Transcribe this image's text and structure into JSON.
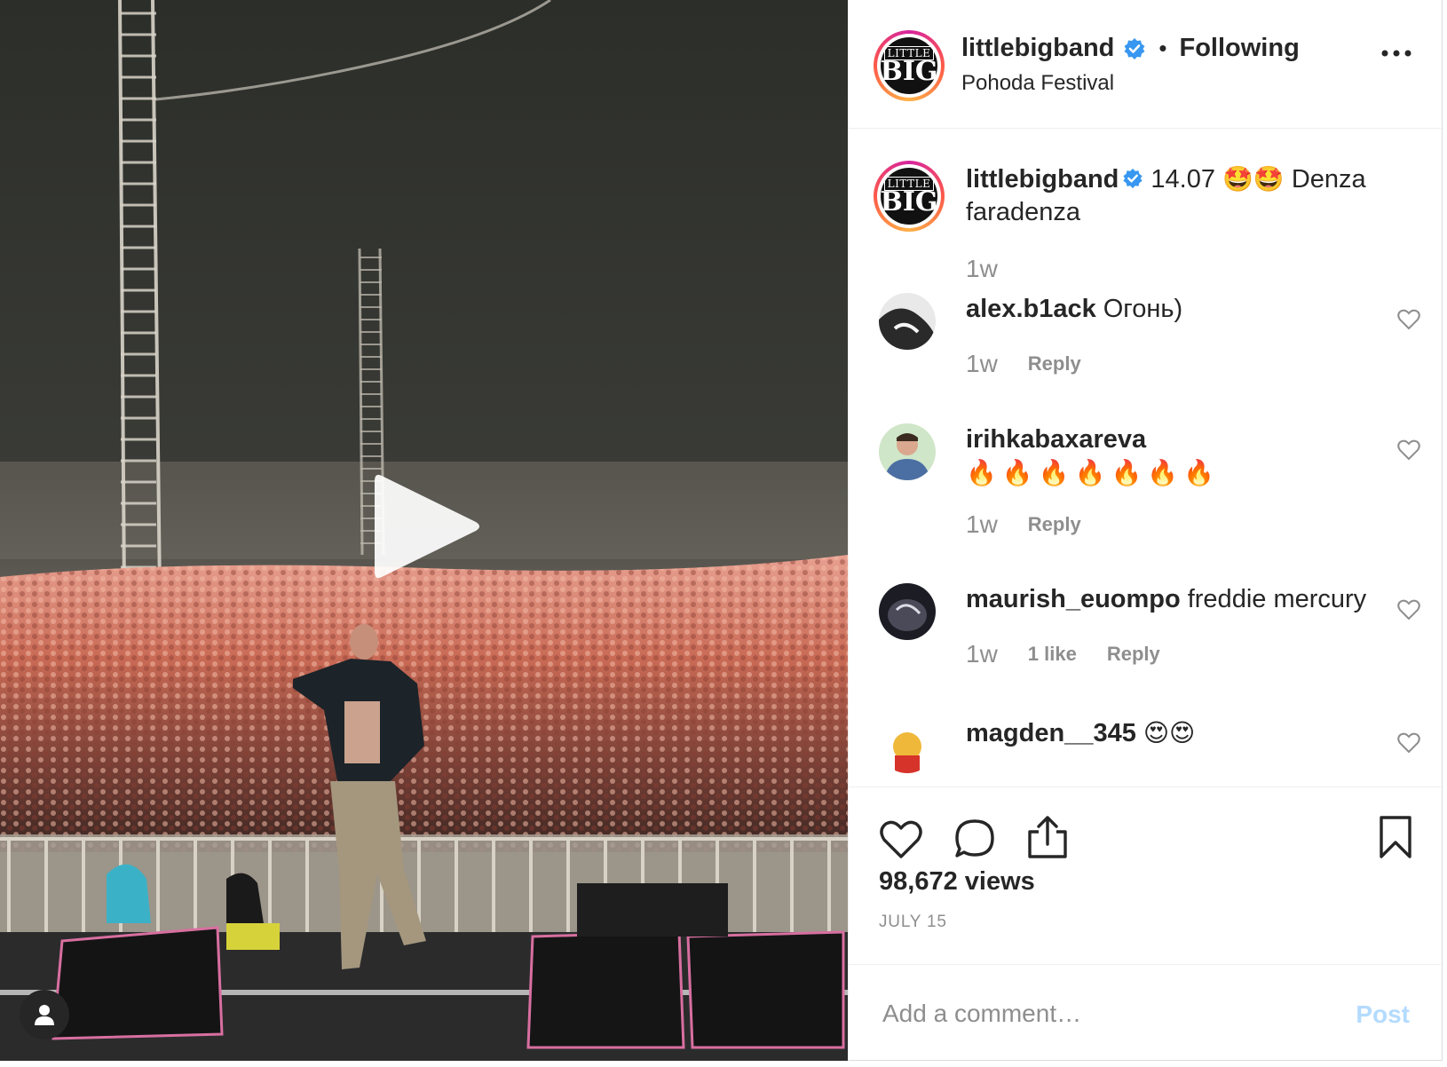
{
  "post": {
    "author": "littlebigband",
    "follow_status": "Following",
    "separator": "•",
    "location": "Pohoda Festival",
    "logo_text_top": "LITTLE",
    "logo_text_bottom": "BIG",
    "media_type": "video",
    "play_icon": "play-icon",
    "user_tag_icon": "person-icon"
  },
  "caption": {
    "username": "littlebigband",
    "text_before": "14.07",
    "emoji": [
      "🤩",
      "🤩"
    ],
    "text_after": "Denza faradenza",
    "time": "1w"
  },
  "comments": [
    {
      "username": "alex.b1ack",
      "text": "Огонь)",
      "time": "1w",
      "likes": "",
      "reply": "Reply"
    },
    {
      "username": "irihkabaxareva",
      "text": "🔥🔥🔥🔥🔥🔥🔥",
      "time": "1w",
      "likes": "",
      "reply": "Reply"
    },
    {
      "username": "maurish_euompo",
      "text": "freddie mercury",
      "time": "1w",
      "likes": "1 like",
      "reply": "Reply"
    },
    {
      "username": "magden__345",
      "text": "😍😍",
      "time": "",
      "likes": "",
      "reply": ""
    }
  ],
  "actions": {
    "like_icon": "heart-icon",
    "comment_icon": "comment-icon",
    "share_icon": "share-icon",
    "save_icon": "bookmark-icon"
  },
  "stats": {
    "views": "98,672 views",
    "date": "JULY 15"
  },
  "add_comment": {
    "placeholder": "Add a comment…",
    "post_label": "Post"
  },
  "colors": {
    "verified": "#3897f0",
    "post_button_disabled": "#b3dbff",
    "muted_text": "#8e8e8e",
    "text": "#262626"
  }
}
